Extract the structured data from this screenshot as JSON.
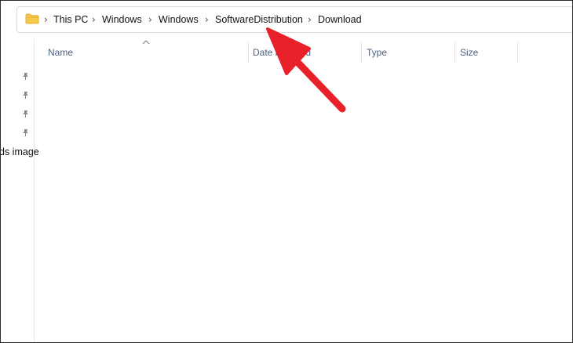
{
  "address_bar": {
    "icon": "folder-icon",
    "breadcrumbs": [
      "This PC",
      "Windows",
      "Windows",
      "SoftwareDistribution",
      "Download"
    ]
  },
  "nav_pane": {
    "pin_icon": "pin-icon",
    "partial_item_label": "ds image"
  },
  "columns": {
    "name": "Name",
    "date_modified": "Date modified",
    "type": "Type",
    "size": "Size"
  },
  "annotation": {
    "arrow_color": "#e8202a"
  },
  "colors": {
    "header_text": "#4a5f82",
    "folder_yellow": "#f7c948"
  }
}
